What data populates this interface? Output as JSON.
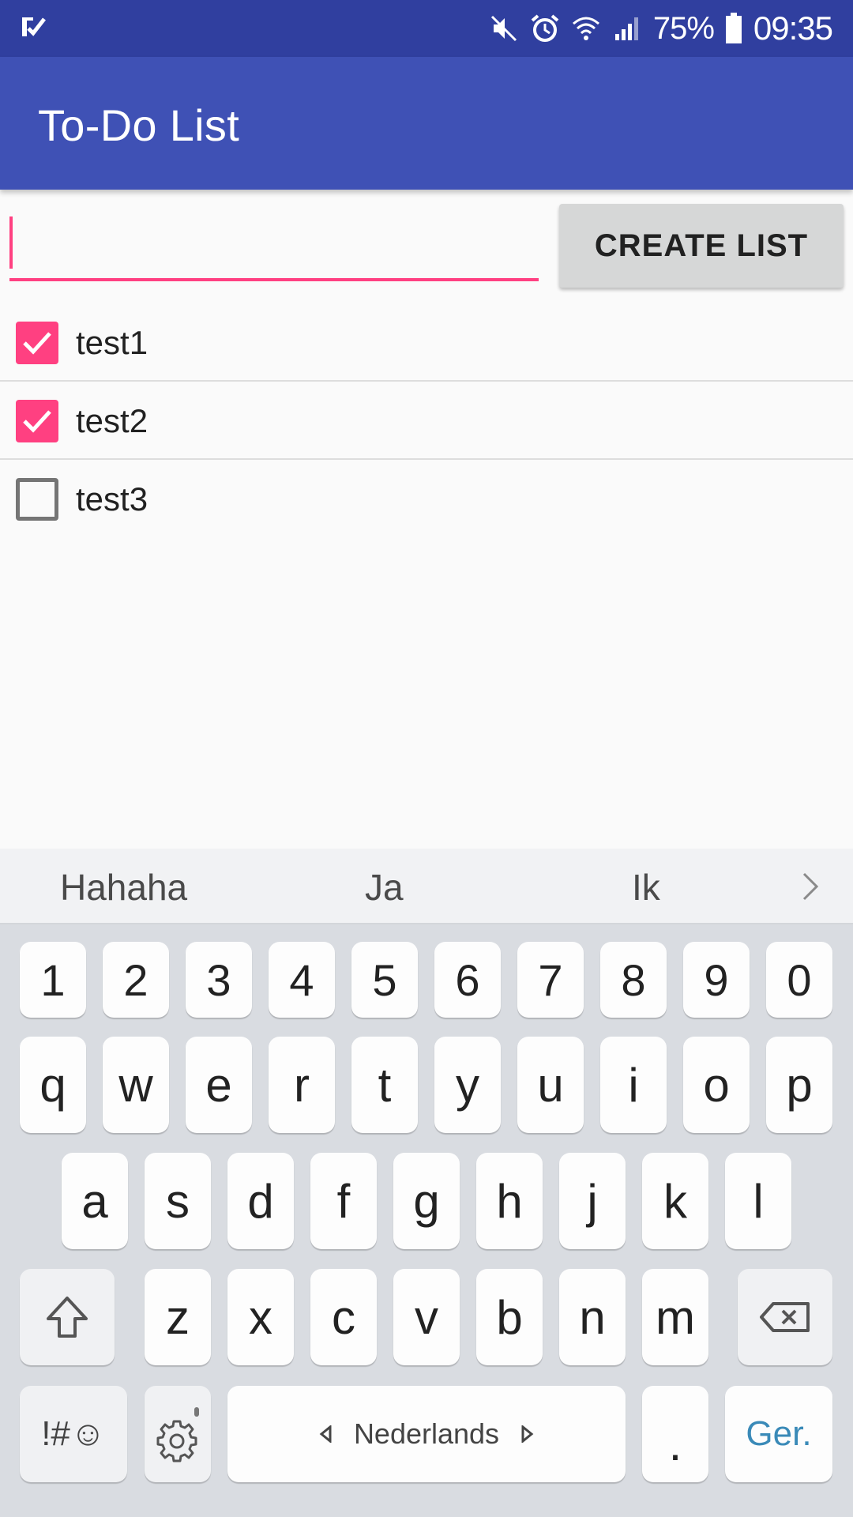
{
  "status_bar": {
    "battery_percent": "75%",
    "time": "09:35",
    "icons": [
      "app-notification-icon",
      "mute-icon",
      "alarm-icon",
      "wifi-icon",
      "signal-icon",
      "battery-icon"
    ]
  },
  "app_bar": {
    "title": "To-Do List"
  },
  "input": {
    "value": "",
    "placeholder": ""
  },
  "create_button": {
    "label": "CREATE LIST"
  },
  "colors": {
    "status_bar": "#303f9f",
    "app_bar": "#3f51b5",
    "accent": "#ff4081"
  },
  "todo_items": [
    {
      "label": "test1",
      "checked": true
    },
    {
      "label": "test2",
      "checked": true
    },
    {
      "label": "test3",
      "checked": false
    }
  ],
  "keyboard": {
    "suggestions": [
      "Hahaha",
      "Ja",
      "Ik"
    ],
    "number_row": [
      "1",
      "2",
      "3",
      "4",
      "5",
      "6",
      "7",
      "8",
      "9",
      "0"
    ],
    "row1": [
      "q",
      "w",
      "e",
      "r",
      "t",
      "y",
      "u",
      "i",
      "o",
      "p"
    ],
    "row2": [
      "a",
      "s",
      "d",
      "f",
      "g",
      "h",
      "j",
      "k",
      "l"
    ],
    "row3": [
      "z",
      "x",
      "c",
      "v",
      "b",
      "n",
      "m"
    ],
    "symbols_label": "!#☺",
    "space_label": "Nederlands",
    "period_label": ".",
    "go_label": "Ger."
  }
}
